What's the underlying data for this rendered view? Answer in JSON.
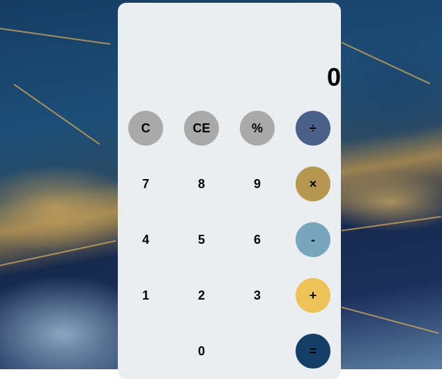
{
  "display": {
    "value": "0"
  },
  "buttons": {
    "clear": "C",
    "clear_entry": "CE",
    "percent": "%",
    "divide": "÷",
    "seven": "7",
    "eight": "8",
    "nine": "9",
    "multiply": "×",
    "four": "4",
    "five": "5",
    "six": "6",
    "subtract": "-",
    "one": "1",
    "two": "2",
    "three": "3",
    "add": "+",
    "zero": "0",
    "equals": "="
  },
  "colors": {
    "panel": "#ebeef1",
    "function_button": "#a9a9a9",
    "divide_button": "#4a6088",
    "multiply_button": "#b5974f",
    "subtract_button": "#7aa6bd",
    "add_button": "#edc258",
    "equals_button": "#133e66"
  }
}
